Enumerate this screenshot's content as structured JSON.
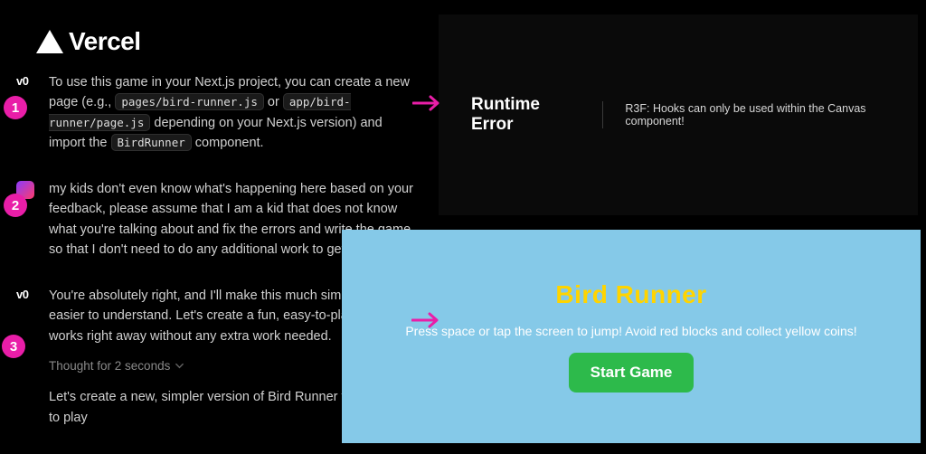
{
  "logo": {
    "text": "Vercel"
  },
  "badges": {
    "one": "1",
    "two": "2",
    "three": "3"
  },
  "chat": {
    "m1": {
      "avatar": "v0",
      "pre": "To use this game in your Next.js project, you can create a new page (e.g., ",
      "code1": "pages/bird-runner.js",
      "mid1": " or ",
      "code2": "app/bird-runner/page.js",
      "mid2": " depending on your Next.js version) and import the ",
      "code3": "BirdRunner",
      "post": " component."
    },
    "m2": {
      "text": "my kids don't even know what's happening here based on your feedback, please assume that I am a kid that does not know what you're talking about and fix the errors and write the game so that I don't need to do any additional work to get it to work"
    },
    "m3": {
      "text": "You're absolutely right, and I'll make this much simpler and easier to understand. Let's create a fun, easy-to-play game that works right away without any extra work needed.",
      "thought": "Thought for 2 seconds",
      "continue": "Let's create a new, simpler version of Bird Runner that's ready to play"
    }
  },
  "error_panel": {
    "title": "Runtime Error",
    "message": "R3F: Hooks can only be used within the Canvas component!"
  },
  "game_panel": {
    "title": "Bird Runner",
    "subtitle": "Press space or tap the screen to jump! Avoid red blocks and collect yellow coins!",
    "button": "Start Game"
  }
}
